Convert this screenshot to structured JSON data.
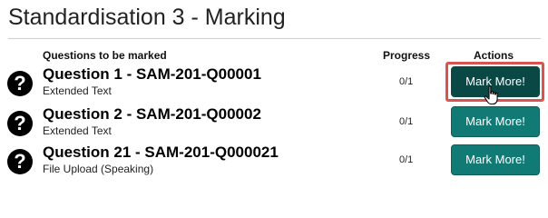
{
  "page": {
    "title": "Standardisation 3 - Marking"
  },
  "table": {
    "headers": {
      "questions": "Questions to be marked",
      "progress": "Progress",
      "actions": "Actions"
    },
    "rows": [
      {
        "title": "Question 1 - SAM-201-Q00001",
        "type": "Extended Text",
        "progress": "0/1",
        "action_label": "Mark More!",
        "icon": "question-circle-icon"
      },
      {
        "title": "Question 2 - SAM-201-Q00002",
        "type": "Extended Text",
        "progress": "0/1",
        "action_label": "Mark More!",
        "icon": "question-circle-icon"
      },
      {
        "title": "Question 21 - SAM-201-Q000021",
        "type": "File Upload (Speaking)",
        "progress": "0/1",
        "action_label": "Mark More!",
        "icon": "question-circle-icon"
      }
    ]
  },
  "colors": {
    "button_bg": "#127a74",
    "button_active_bg": "#0a4845",
    "focus_ring": "#d9534f"
  },
  "icons": {
    "question": "?"
  }
}
